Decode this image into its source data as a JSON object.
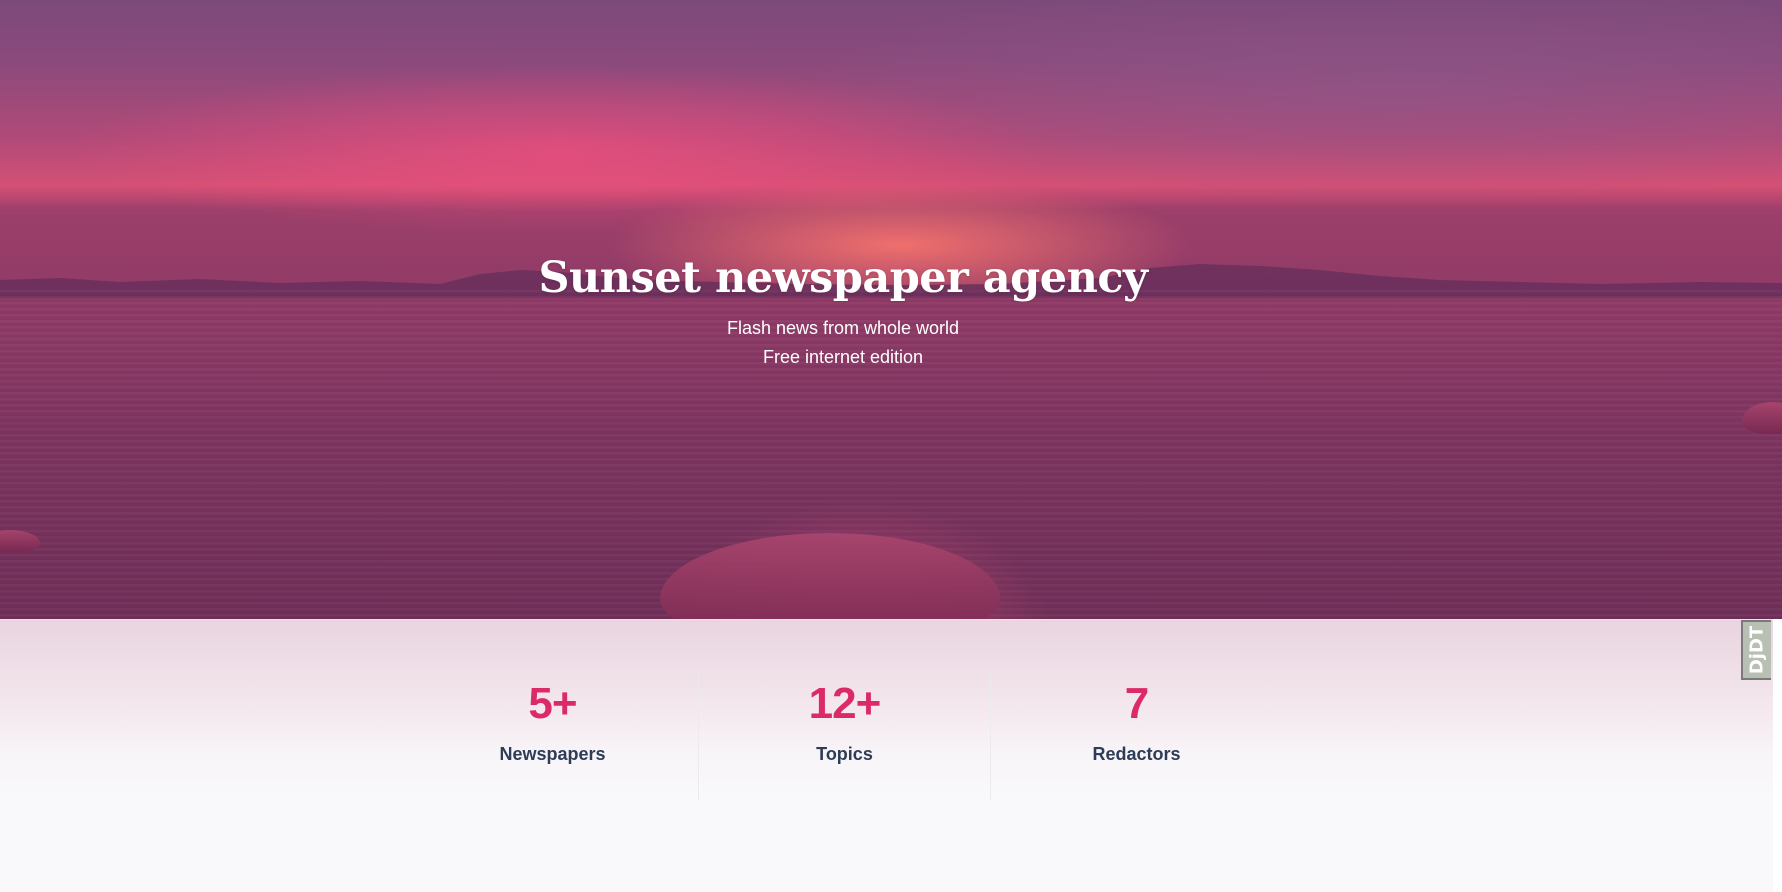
{
  "hero": {
    "title": "Sunset newspaper agency",
    "subtitle_line1": "Flash news from whole world",
    "subtitle_line2": "Free internet edition"
  },
  "stats": [
    {
      "value": "5+",
      "label": "Newspapers"
    },
    {
      "value": "12+",
      "label": "Topics"
    },
    {
      "value": "7",
      "label": "Redactors"
    }
  ],
  "debug_toolbar": {
    "handle_label": "DjDT"
  },
  "colors": {
    "stat_value": "#dc2a67",
    "stat_label": "#2e3d57",
    "hero_overlay": "#8e3a66"
  }
}
